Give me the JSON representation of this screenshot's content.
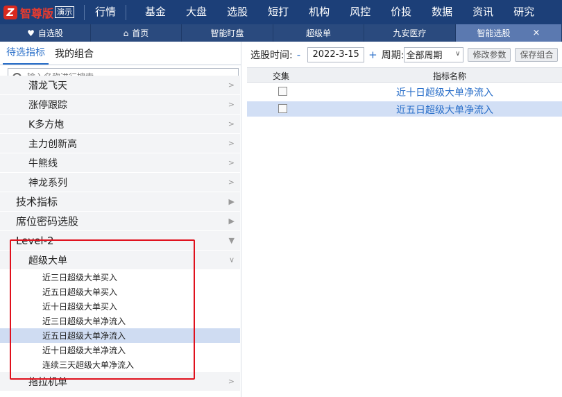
{
  "topbar": {
    "logo_mark": "Z",
    "logo_name": "智尊版",
    "logo_badge": "演示",
    "menu": [
      "行情",
      "基金",
      "大盘",
      "选股",
      "短打",
      "机构",
      "风控",
      "价投",
      "数据",
      "资讯",
      "研究"
    ]
  },
  "tabs": [
    {
      "label": "自选股",
      "icon": "heart-icon"
    },
    {
      "label": "首页",
      "icon": "home-icon"
    },
    {
      "label": "智能盯盘"
    },
    {
      "label": "超级单"
    },
    {
      "label": "九安医疗"
    },
    {
      "label": "智能选股",
      "active": true,
      "close": "×"
    }
  ],
  "left": {
    "tabs": [
      "待选指标",
      "我的组合"
    ],
    "search_placeholder": "输入名称进行搜索",
    "tree": [
      {
        "label": "潜龙飞天",
        "level": 2,
        "arrow": ">"
      },
      {
        "label": "涨停跟踪",
        "level": 2,
        "arrow": ">"
      },
      {
        "label": "K多方炮",
        "level": 2,
        "arrow": ">"
      },
      {
        "label": "主力创新高",
        "level": 2,
        "arrow": ">"
      },
      {
        "label": "牛熊线",
        "level": 2,
        "arrow": ">"
      },
      {
        "label": "神龙系列",
        "level": 2,
        "arrow": ">"
      },
      {
        "label": "技术指标",
        "level": 1,
        "arrow": "▶"
      },
      {
        "label": "席位密码选股",
        "level": 1,
        "arrow": "▶"
      },
      {
        "label": "Level-2",
        "level": 1,
        "arrow": "▼"
      },
      {
        "label": "超级大单",
        "level": 2,
        "arrow": "∨"
      },
      {
        "label": "近三日超级大单买入",
        "level": 3
      },
      {
        "label": "近五日超级大单买入",
        "level": 3
      },
      {
        "label": "近十日超级大单买入",
        "level": 3
      },
      {
        "label": "近三日超级大单净流入",
        "level": 3
      },
      {
        "label": "近五日超级大单净流入",
        "level": 3,
        "selected": true
      },
      {
        "label": "近十日超级大单净流入",
        "level": 3
      },
      {
        "label": "连续三天超级大单净流入",
        "level": 3
      },
      {
        "label": "拖拉机单",
        "level": 2,
        "arrow": ">"
      }
    ]
  },
  "right": {
    "time_label": "选股时间:",
    "minus": "-",
    "date": "2022-3-15",
    "plus": "+",
    "period_label": "周期:",
    "period_value": "全部周期",
    "btn_modify": "修改参数",
    "btn_save": "保存组合",
    "col_intersect": "交集",
    "col_name": "指标名称",
    "rows": [
      {
        "name": "近十日超级大单净流入",
        "checked": false,
        "selected": false
      },
      {
        "name": "近五日超级大单净流入",
        "checked": false,
        "selected": true
      }
    ]
  }
}
